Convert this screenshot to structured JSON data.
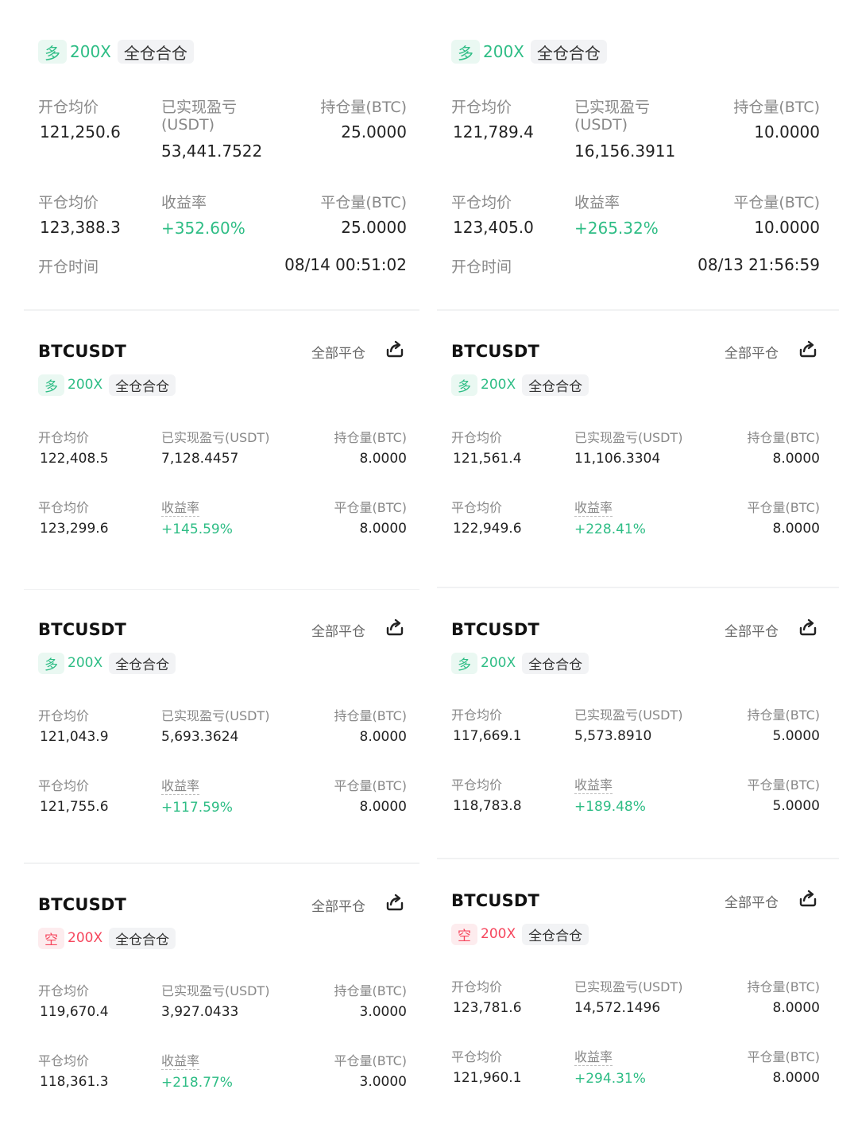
{
  "labels": {
    "open_avg": "开仓均价",
    "realized_pnl": "已实现盈亏(USDT)",
    "realized_pnl_line1": "已实现盈亏",
    "realized_pnl_line2": "(USDT)",
    "position_size": "持仓量(BTC)",
    "close_avg": "平仓均价",
    "roi": "收益率",
    "close_size": "平仓量(BTC)",
    "open_time": "开仓时间",
    "close_all": "全部平仓",
    "symbol": "BTCUSDT",
    "mode": "全仓合仓",
    "dir_long": "多",
    "dir_short": "空",
    "leverage": "200X"
  },
  "icons": {
    "share": "share-icon"
  },
  "colors": {
    "green": "#2ebd85",
    "red": "#f6465d"
  },
  "cards": [
    {
      "open_avg": "121,250.6",
      "realized_pnl": "53,441.7522",
      "position_size": "25.0000",
      "close_avg": "123,388.3",
      "roi": "+352.60%",
      "close_size": "25.0000",
      "open_time": "08/14 00:51:02"
    },
    {
      "open_avg": "121,789.4",
      "realized_pnl": "16,156.3911",
      "position_size": "10.0000",
      "close_avg": "123,405.0",
      "roi": "+265.32%",
      "close_size": "10.0000",
      "open_time": "08/13 21:56:59"
    },
    {
      "open_avg": "122,408.5",
      "realized_pnl": "7,128.4457",
      "position_size": "8.0000",
      "close_avg": "123,299.6",
      "roi": "+145.59%",
      "close_size": "8.0000"
    },
    {
      "open_avg": "121,561.4",
      "realized_pnl": "11,106.3304",
      "position_size": "8.0000",
      "close_avg": "122,949.6",
      "roi": "+228.41%",
      "close_size": "8.0000"
    },
    {
      "open_avg": "121,043.9",
      "realized_pnl": "5,693.3624",
      "position_size": "8.0000",
      "close_avg": "121,755.6",
      "roi": "+117.59%",
      "close_size": "8.0000"
    },
    {
      "open_avg": "117,669.1",
      "realized_pnl": "5,573.8910",
      "position_size": "5.0000",
      "close_avg": "118,783.8",
      "roi": "+189.48%",
      "close_size": "5.0000"
    },
    {
      "open_avg": "119,670.4",
      "realized_pnl": "3,927.0433",
      "position_size": "3.0000",
      "close_avg": "118,361.3",
      "roi": "+218.77%",
      "close_size": "3.0000"
    },
    {
      "open_avg": "123,781.6",
      "realized_pnl": "14,572.1496",
      "position_size": "8.0000",
      "close_avg": "121,960.1",
      "roi": "+294.31%",
      "close_size": "8.0000"
    }
  ]
}
